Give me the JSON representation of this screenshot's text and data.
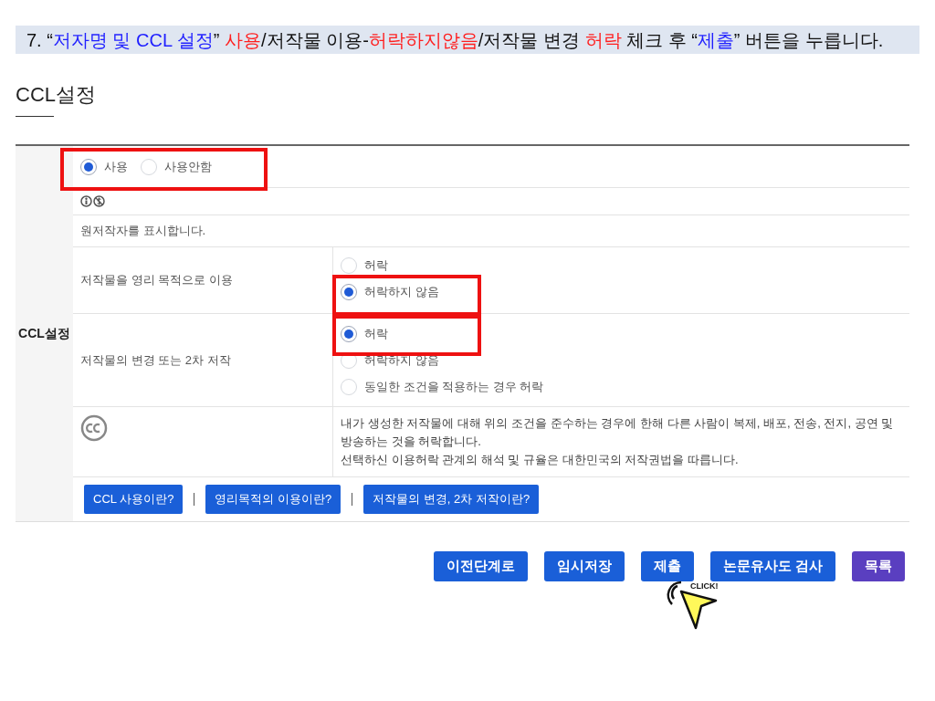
{
  "instruction": {
    "segments": [
      {
        "text": "7. “",
        "color": "#111111"
      },
      {
        "text": "저자명 및 CCL 설정",
        "color": "#1f1fff"
      },
      {
        "text": "” ",
        "color": "#111111"
      },
      {
        "text": "사용",
        "color": "#ff1f1f"
      },
      {
        "text": "/저작물 이용-",
        "color": "#111111"
      },
      {
        "text": "허락하지않음",
        "color": "#ff1f1f"
      },
      {
        "text": "/저작물 변경 ",
        "color": "#111111"
      },
      {
        "text": "허락",
        "color": "#ff1f1f"
      },
      {
        "text": " 체크 후 “",
        "color": "#111111"
      },
      {
        "text": "제출",
        "color": "#1f1fff"
      },
      {
        "text": "” 버튼을 누릅니다.",
        "color": "#111111"
      }
    ]
  },
  "section_title": "CCL설정",
  "form": {
    "label": "CCL설정",
    "usage_options": [
      {
        "label": "사용",
        "selected": true
      },
      {
        "label": "사용안함",
        "selected": false
      }
    ],
    "description": "원저작자를 표시합니다.",
    "conditions": [
      {
        "label": "저작물을 영리 목적으로 이용",
        "options": [
          {
            "label": "허락",
            "selected": false
          },
          {
            "label": "허락하지 않음",
            "selected": true
          }
        ]
      },
      {
        "label": "저작물의 변경 또는 2차 저작",
        "options": [
          {
            "label": "허락",
            "selected": true
          },
          {
            "label": "허락하지 않음",
            "selected": false
          },
          {
            "label": "동일한 조건을 적용하는 경우 허락",
            "selected": false
          }
        ]
      }
    ],
    "notice_lines": [
      "내가 생성한 저작물에 대해 위의 조건을 준수하는 경우에 한해 다른 사람이 복제, 배포, 전송, 전지, 공연 및 방송하는 것을 허락합니다.",
      "선택하신 이용허락 관계의 해석 및 규율은 대한민국의 저작권법을 따릅니다."
    ],
    "help_buttons": [
      "CCL 사용이란?",
      "영리목적의 이용이란?",
      "저작물의 변경, 2차 저작이란?"
    ]
  },
  "actions": [
    {
      "label": "이전단계로",
      "kind": "primary"
    },
    {
      "label": "임시저장",
      "kind": "primary"
    },
    {
      "label": "제출",
      "kind": "primary"
    },
    {
      "label": "논문유사도 검사",
      "kind": "primary"
    },
    {
      "label": "목록",
      "kind": "secondary"
    }
  ],
  "click_hint": "CLICK!"
}
